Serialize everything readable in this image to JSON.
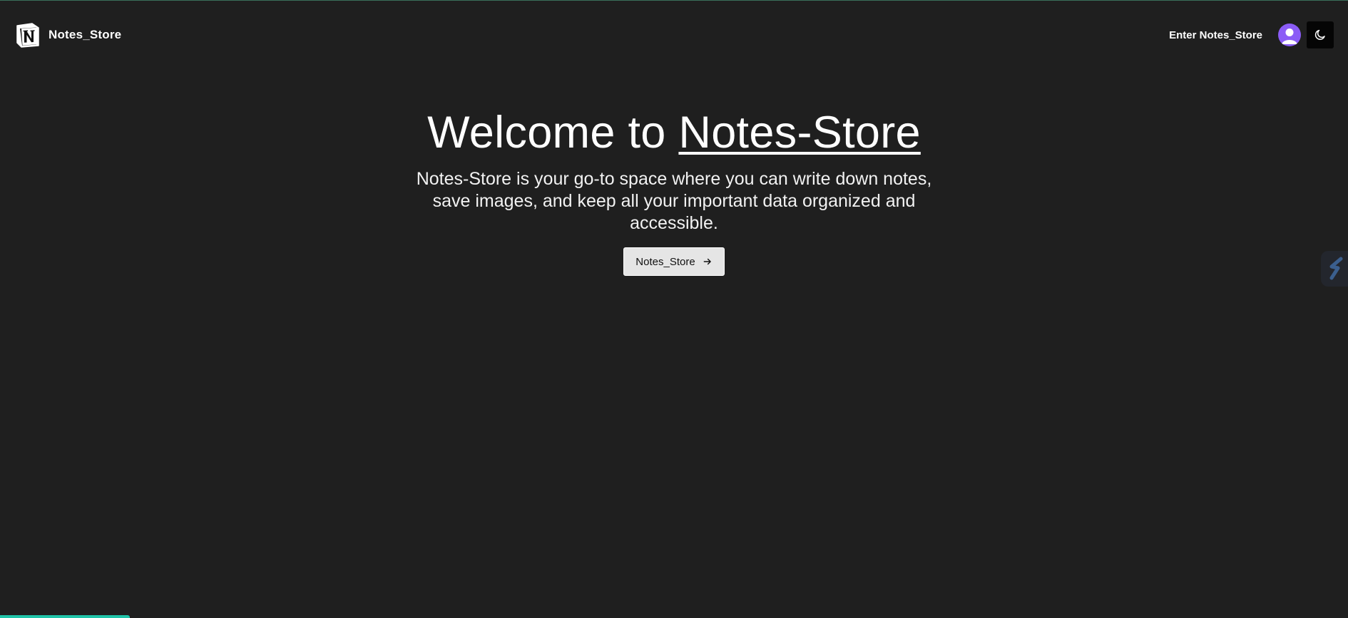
{
  "navbar": {
    "brand_name": "Notes_Store",
    "enter_label": "Enter Notes_Store",
    "icons": [
      "notion-logo-icon",
      "user-avatar-icon",
      "moon-icon"
    ]
  },
  "hero": {
    "title_prefix": "Welcome to ",
    "title_highlight": "Notes-Store",
    "description": "Notes-Store is your go-to space where you can write down notes, save images, and keep all your important data organized and accessible.",
    "cta_label": "Notes_Store",
    "cta_icon": "arrow-right-icon"
  },
  "side_widget": {
    "icon": "extension-s-icon"
  },
  "colors": {
    "background": "#1f1f1f",
    "avatar": "#8b5cf6",
    "progress": "#20c3a8",
    "button_bg": "#e5e5e5"
  }
}
